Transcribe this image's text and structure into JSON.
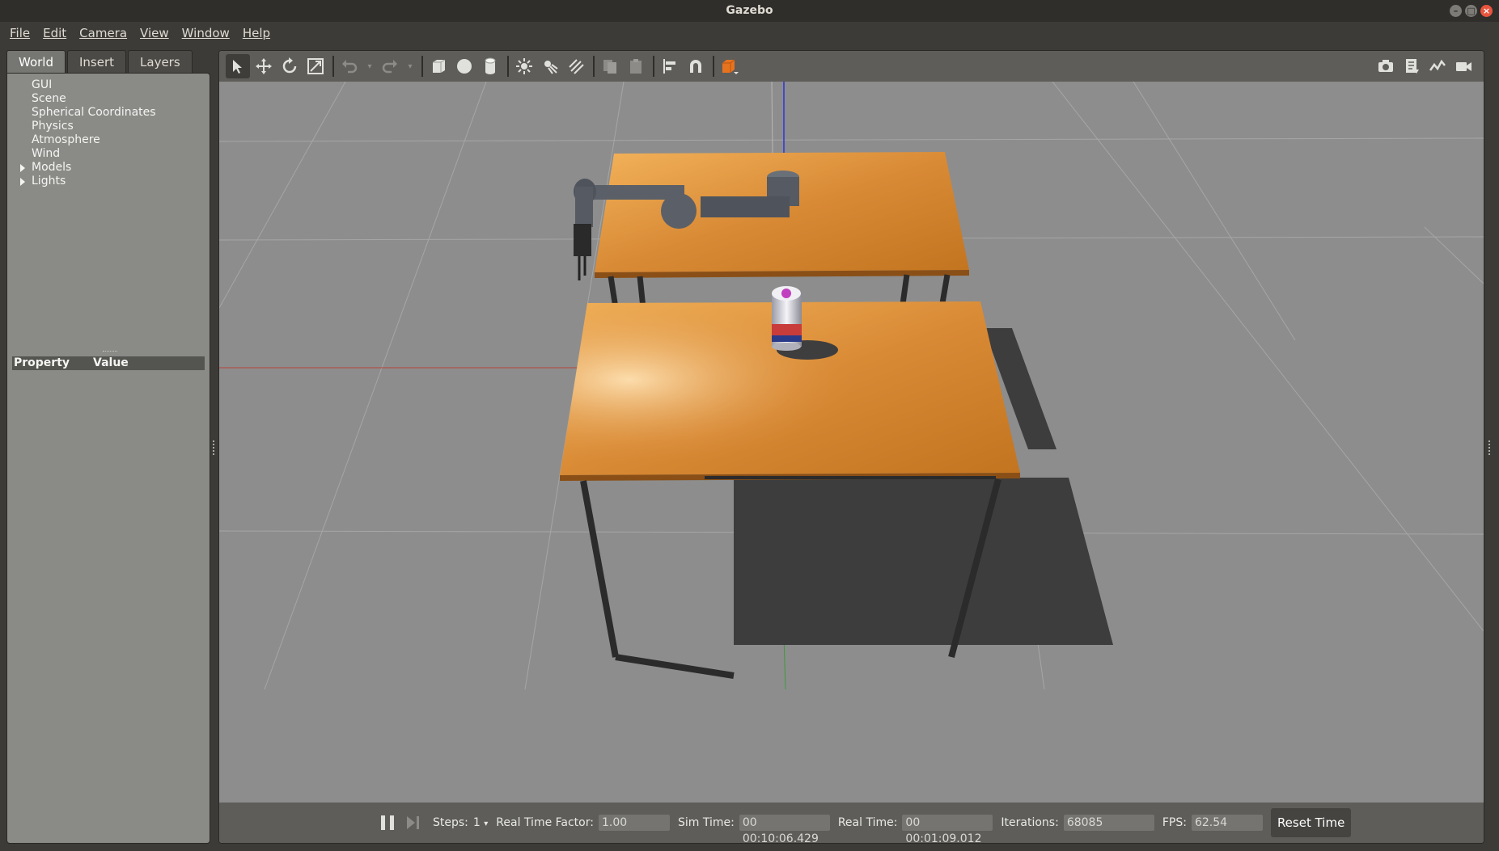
{
  "window": {
    "title": "Gazebo"
  },
  "menu": {
    "items": [
      {
        "label": "File"
      },
      {
        "label": "Edit"
      },
      {
        "label": "Camera"
      },
      {
        "label": "View"
      },
      {
        "label": "Window"
      },
      {
        "label": "Help"
      }
    ]
  },
  "left_panel": {
    "tabs": [
      {
        "label": "World"
      },
      {
        "label": "Insert"
      },
      {
        "label": "Layers"
      }
    ],
    "tree": [
      "GUI",
      "Scene",
      "Spherical Coordinates",
      "Physics",
      "Atmosphere",
      "Wind",
      "Models",
      "Lights"
    ],
    "property_header": {
      "property": "Property",
      "value": "Value"
    }
  },
  "toolbar": {
    "tools": [
      "select-arrow-icon",
      "translate-icon",
      "rotate-icon",
      "scale-icon",
      "undo-icon",
      "redo-icon",
      "box-icon",
      "sphere-icon",
      "cylinder-icon",
      "point-light-icon",
      "spot-light-icon",
      "directional-light-icon",
      "copy-icon",
      "paste-icon",
      "align-icon",
      "magnet-icon",
      "view-angle-icon"
    ],
    "right_tools": [
      "screenshot-icon",
      "log-icon",
      "plot-icon",
      "video-record-icon"
    ]
  },
  "bottom_bar": {
    "steps_label": "Steps:",
    "steps_value": "1",
    "rtf_label": "Real Time Factor:",
    "rtf_value": "1.00",
    "sim_time_label": "Sim Time:",
    "sim_time_value": "00 00:10:06.429",
    "real_time_label": "Real Time:",
    "real_time_value": "00 00:01:09.012",
    "iterations_label": "Iterations:",
    "iterations_value": "68085",
    "fps_label": "FPS:",
    "fps_value": "62.54",
    "reset_label": "Reset Time"
  },
  "colors": {
    "ground": "#8d8d8d",
    "table_wood": "#d98a35",
    "table_leg": "#2b2b2b",
    "robot": "#5b6068",
    "shadow": "#3e3e3e"
  }
}
